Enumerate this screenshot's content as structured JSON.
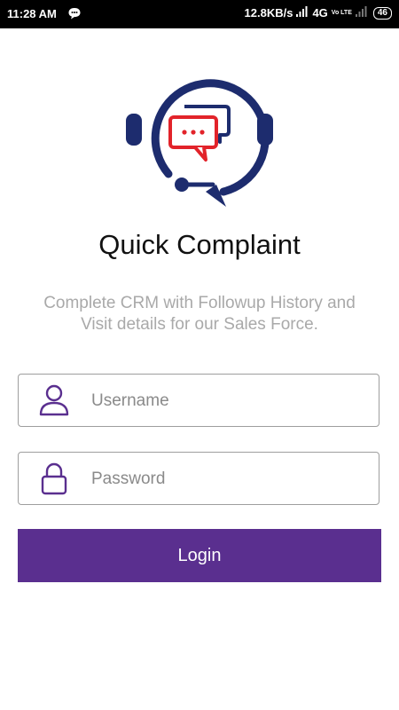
{
  "status_bar": {
    "time": "11:28 AM",
    "network_speed": "12.8KB/s",
    "network_type": "4G",
    "volte_label": "Vo LTE",
    "battery": "46"
  },
  "app": {
    "title": "Quick Complaint",
    "subtitle": "Complete CRM with Followup History and Visit details for our Sales Force."
  },
  "form": {
    "username": {
      "value": "",
      "placeholder": "Username",
      "icon": "user-icon"
    },
    "password": {
      "value": "",
      "placeholder": "Password",
      "icon": "lock-icon"
    },
    "login_label": "Login"
  },
  "colors": {
    "accent": "#5a2f8f",
    "logo_navy": "#1d2c6e",
    "logo_red": "#e2232a",
    "field_icon": "#5a2f8f"
  }
}
